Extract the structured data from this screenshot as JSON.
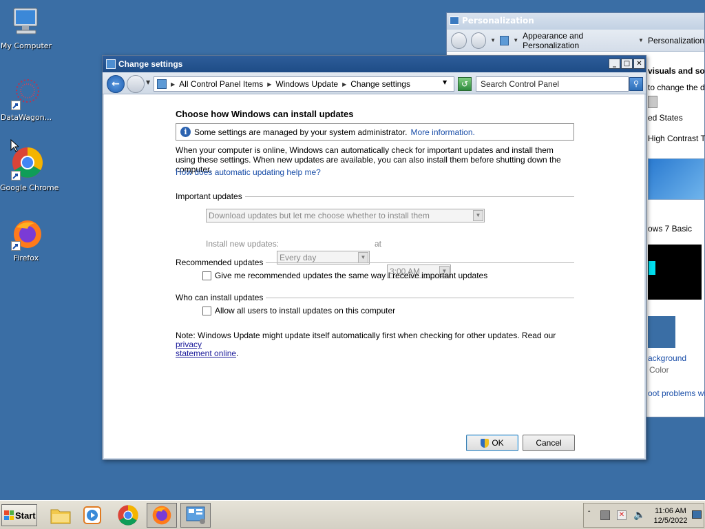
{
  "desktop": {
    "icons": [
      {
        "label": "My Computer"
      },
      {
        "label": "DataWagon..."
      },
      {
        "label": "Google Chrome"
      },
      {
        "label": "Firefox"
      }
    ]
  },
  "background_window": {
    "title": "Personalization",
    "breadcrumb": [
      "Appearance and Personalization",
      "Personalization"
    ],
    "fragments": [
      "visuals and sou",
      "to change the des",
      "ed States",
      "High Contrast Th",
      "ows 7 Basic",
      "ackground",
      "Color",
      "oot problems with"
    ]
  },
  "dialog": {
    "title": "Change settings",
    "breadcrumb": [
      "All Control Panel Items",
      "Windows Update",
      "Change settings"
    ],
    "search_placeholder": "Search Control Panel",
    "heading": "Choose how Windows can install updates",
    "info_text": "Some settings are managed by your system administrator.",
    "info_link": "More information.",
    "description": "When your computer is online, Windows can automatically check for important updates and install them using these settings. When new updates are available, you can also install them before shutting down the computer.",
    "help_link": "How does automatic updating help me?",
    "important_updates": {
      "section_label": "Important updates",
      "selected_option": "Download updates but let me choose whether to install them",
      "install_label": "Install new updates:",
      "day_value": "Every day",
      "at_label": "at",
      "time_value": "3:00 AM"
    },
    "recommended_updates": {
      "section_label": "Recommended updates",
      "checkbox_label": "Give me recommended updates the same way I receive important updates",
      "checked": false
    },
    "who_can_install": {
      "section_label": "Who can install updates",
      "checkbox_label": "Allow all users to install updates on this computer",
      "checked": false
    },
    "note_text": "Note: Windows Update might update itself automatically first when checking for other updates.  Read our",
    "privacy_link_1": "privacy",
    "privacy_link_2": "statement online",
    "note_end": ".",
    "ok_label": "OK",
    "cancel_label": "Cancel",
    "caption_buttons": {
      "minimize": "_",
      "maximize": "□",
      "close": "✕"
    }
  },
  "taskbar": {
    "start_label": "Start",
    "apps": [
      "file-explorer",
      "media-player",
      "google-chrome",
      "firefox",
      "control-panel"
    ],
    "clock_time": "11:06 AM",
    "clock_date": "12/5/2022"
  },
  "colors": {
    "desktop": "#3a6ea5",
    "link": "#1a4ea8",
    "title_bar": "#1e4c86"
  }
}
